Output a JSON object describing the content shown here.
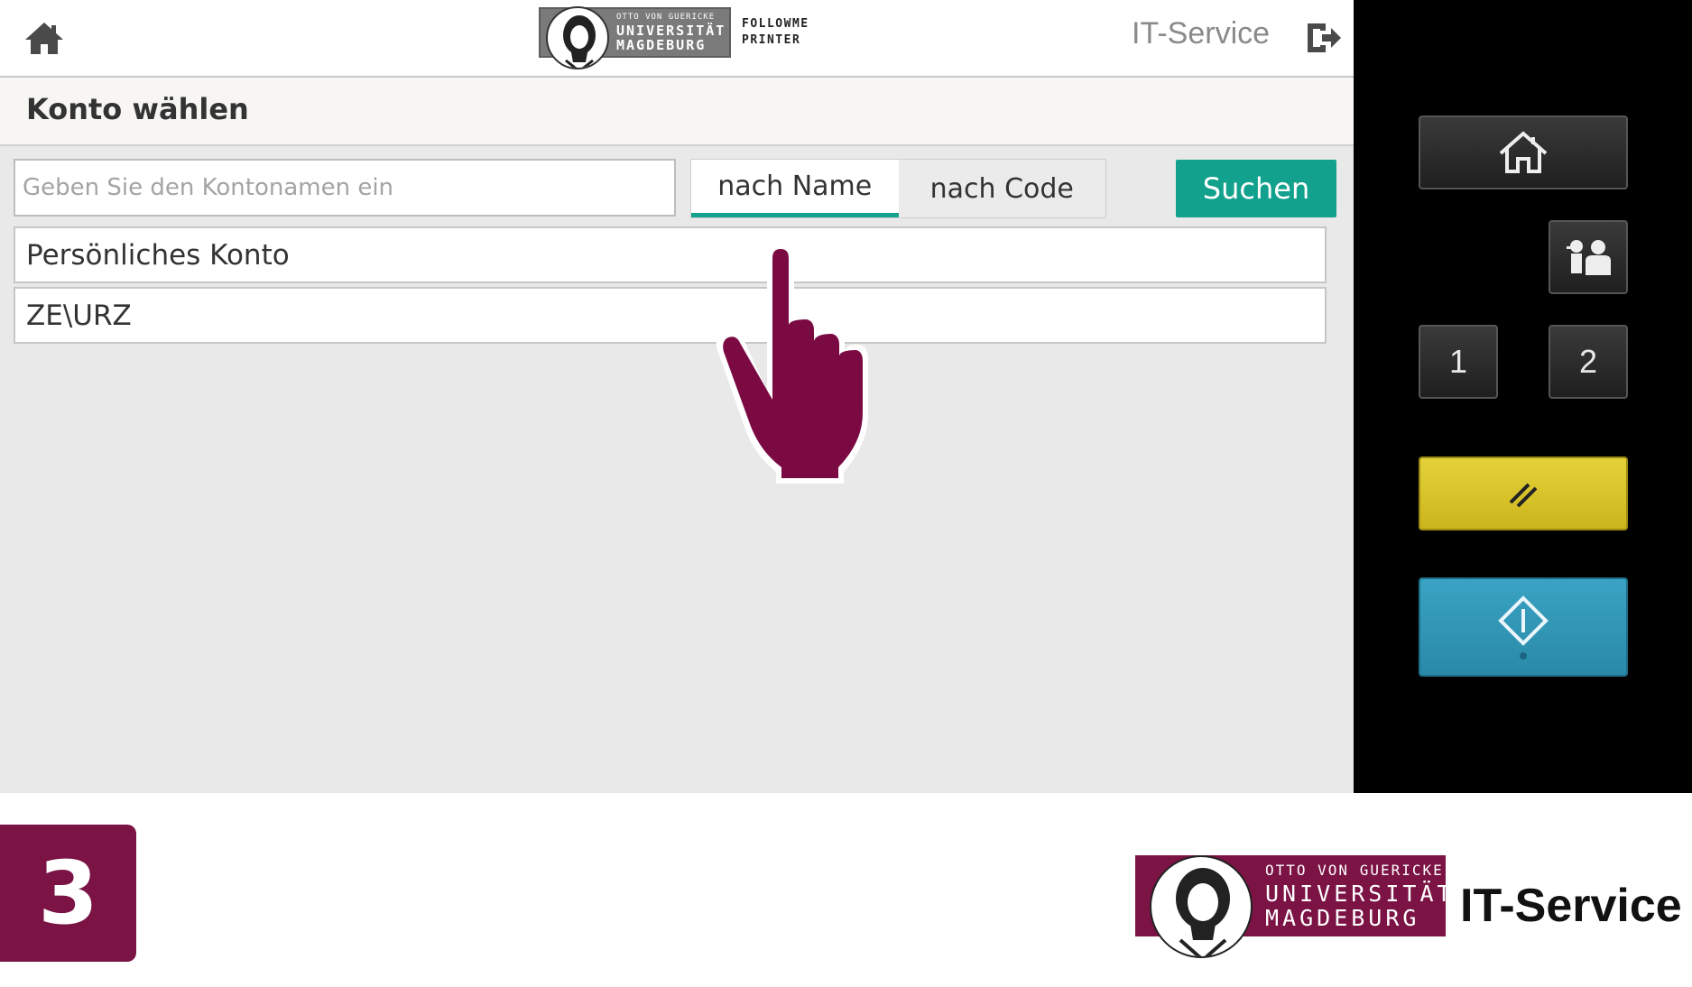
{
  "header": {
    "logo": {
      "line1": "OTTO VON GUERICKE",
      "line2": "UNIVERSITÄT",
      "line3": "MAGDEBURG"
    },
    "followme_line1": "FOLLOWME",
    "followme_line2": "PRINTER",
    "service_label": "IT-Service",
    "home_icon": "home-icon",
    "logout_icon": "logout-icon"
  },
  "page": {
    "title": "Konto wählen"
  },
  "search": {
    "placeholder": "Geben Sie den Kontonamen ein",
    "value": "",
    "tabs": [
      {
        "label": "nach Name",
        "active": true
      },
      {
        "label": "nach Code",
        "active": false
      }
    ],
    "button_label": "Suchen"
  },
  "accounts": [
    {
      "label": "Persönliches Konto"
    },
    {
      "label": "ZE\\URZ"
    }
  ],
  "hardware_panel": {
    "home_icon": "home-icon",
    "user_icon": "user-login-icon",
    "button_1": "1",
    "button_2": "2",
    "reset_icon": "reset-icon",
    "start_icon": "start-icon"
  },
  "footer": {
    "step_number": "3",
    "logo": {
      "line1": "OTTO VON GUERICKE",
      "line2": "UNIVERSITÄT",
      "line3": "MAGDEBURG"
    },
    "service_label": "IT-Service"
  },
  "colors": {
    "accent_teal": "#11a18c",
    "brand_maroon": "#7b1344",
    "reset_yellow": "#e5d23a",
    "start_blue": "#3aa3c3"
  }
}
